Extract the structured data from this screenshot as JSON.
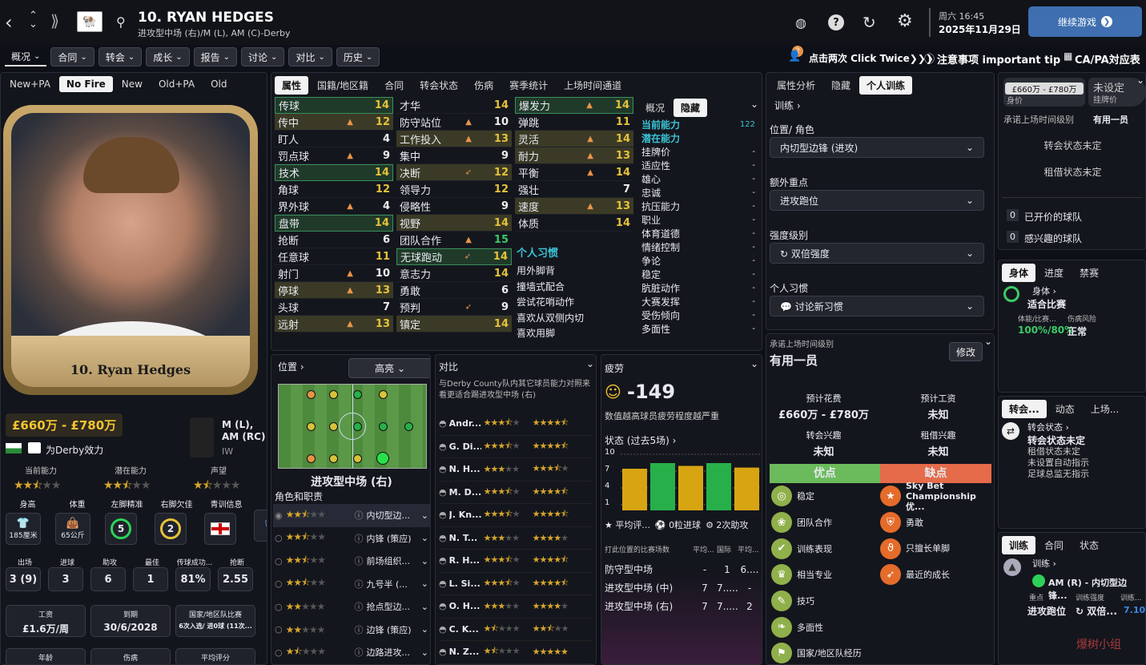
{
  "header": {
    "name": "10. RYAN HEDGES",
    "sub": "进攻型中场 (右)/M (L), AM (C)-Derby",
    "time": "周六 16:45",
    "date": "2025年11月29日",
    "continue": "继续游戏"
  },
  "menu": [
    "概况",
    "合同",
    "转会",
    "成长",
    "报告",
    "讨论",
    "对比",
    "历史"
  ],
  "tips": {
    "badge": "2",
    "click": "点击两次 Click Twice❯❯❯",
    "important": "注意事项 important tip",
    "capa": "CA/PA対应表"
  },
  "left": {
    "filters": [
      "New+PA",
      "No Fire",
      "New",
      "Old+PA",
      "Old"
    ],
    "card_name": "10. Ryan Hedges",
    "value": "£660万 - £780万",
    "club": "为Derby效力",
    "pos": "M (L), AM (RC)",
    "role": "IW",
    "labels": {
      "ca": "当前能力",
      "pa": "潜在能力",
      "rep": "声望"
    },
    "stats1": [
      {
        "l": "身高",
        "v": "185厘米"
      },
      {
        "l": "体重",
        "v": "65公斤"
      },
      {
        "l": "左脚精准",
        "v": "5"
      },
      {
        "l": "右脚欠佳",
        "v": "2"
      },
      {
        "l": "青训信息",
        "v": ""
      }
    ],
    "stats2": [
      {
        "l": "出场",
        "v": "3 (9)"
      },
      {
        "l": "进球",
        "v": "3"
      },
      {
        "l": "助攻",
        "v": "6"
      },
      {
        "l": "最佳",
        "v": "1"
      },
      {
        "l": "传球成功...",
        "v": "81%"
      },
      {
        "l": "抢断",
        "v": "2.55"
      }
    ],
    "stats3": [
      {
        "l": "工资",
        "v": "£1.6万/周"
      },
      {
        "l": "到期",
        "v": "30/6/2028"
      },
      {
        "l": "国家/地区队比赛",
        "v": "6次入选/ 进0球 (11次..."
      }
    ],
    "stats4": [
      "年龄",
      "伤病",
      "平均评分"
    ]
  },
  "attrs": {
    "tabs": [
      "属性",
      "国籍/地区籍",
      "合同",
      "转会状态",
      "伤病",
      "赛季统计",
      "上场时间通道"
    ],
    "col1": [
      [
        "传球",
        "14"
      ],
      [
        "传中",
        "12"
      ],
      [
        "盯人",
        "4"
      ],
      [
        "罚点球",
        "9"
      ],
      [
        "技术",
        "14"
      ],
      [
        "角球",
        "12"
      ],
      [
        "界外球",
        "4"
      ],
      [
        "盘带",
        "14"
      ],
      [
        "抢断",
        "6"
      ],
      [
        "任意球",
        "11"
      ],
      [
        "射门",
        "10"
      ],
      [
        "停球",
        "13"
      ],
      [
        "头球",
        "7"
      ],
      [
        "远射",
        "13"
      ]
    ],
    "col2": [
      [
        "才华",
        "14"
      ],
      [
        "防守站位",
        "10"
      ],
      [
        "工作投入",
        "13"
      ],
      [
        "集中",
        "9"
      ],
      [
        "决断",
        "12"
      ],
      [
        "领导力",
        "12"
      ],
      [
        "侵略性",
        "9"
      ],
      [
        "视野",
        "14"
      ],
      [
        "团队合作",
        "15"
      ],
      [
        "无球跑动",
        "14"
      ],
      [
        "意志力",
        "14"
      ],
      [
        "勇敢",
        "6"
      ],
      [
        "预判",
        "9"
      ],
      [
        "镇定",
        "14"
      ]
    ],
    "col3": [
      [
        "爆发力",
        "14"
      ],
      [
        "弹跳",
        "11"
      ],
      [
        "灵活",
        "14"
      ],
      [
        "耐力",
        "13"
      ],
      [
        "平衡",
        "14"
      ],
      [
        "强壮",
        "7"
      ],
      [
        "速度",
        "13"
      ],
      [
        "体质",
        "14"
      ]
    ],
    "habits_title": "个人习惯",
    "habits": [
      "用外脚背",
      "撞墙式配合",
      "尝试花哨动作",
      "喜欢从双侧内切",
      "喜欢用脚"
    ],
    "hid_tabs": [
      "概况",
      "隐藏"
    ],
    "hidden": [
      [
        "当前能力",
        "122"
      ],
      [
        "潜在能力",
        ""
      ],
      [
        "挂牌价",
        "-"
      ],
      [
        "适应性",
        "-"
      ],
      [
        "雄心",
        "-"
      ],
      [
        "忠诚",
        "-"
      ],
      [
        "抗压能力",
        "-"
      ],
      [
        "职业",
        "-"
      ],
      [
        "体育道德",
        "-"
      ],
      [
        "情绪控制",
        "-"
      ],
      [
        "争论",
        "-"
      ],
      [
        "稳定",
        "-"
      ],
      [
        "肮脏动作",
        "-"
      ],
      [
        "大赛发挥",
        "-"
      ],
      [
        "受伤倾向",
        "-"
      ],
      [
        "多面性",
        "-"
      ]
    ]
  },
  "position": {
    "title": "位置",
    "highlight": "高亮",
    "role": "进攻型中场 (右)",
    "roles_title": "角色和职责",
    "roles": [
      "内切型边...",
      "内锋 (策应)",
      "前场组织...",
      "九号半 (...",
      "抢点型边...",
      "边锋 (策应)",
      "边路进攻..."
    ]
  },
  "compare": {
    "title": "对比",
    "desc": "与Derby County队内其它球员能力对照来看更适合踢进攻型中场 (右)",
    "players": [
      "Andr...",
      "G. Di...",
      "N. H...",
      "M. D...",
      "J. Kn...",
      "N. T...",
      "R. H...",
      "L. Si...",
      "O. H...",
      "C. K...",
      "N. Z..."
    ]
  },
  "fatigue": {
    "title": "疲劳",
    "value": "-149",
    "desc": "数值越高球员疲劳程度越严重",
    "form": "状态 (过去5场)",
    "bars": [
      7,
      8,
      7.5,
      8,
      7.2
    ],
    "yticks": [
      "10",
      "7",
      "4",
      "1"
    ],
    "legend": [
      "平均评...",
      "0粒进球",
      "2次助攻"
    ],
    "pos_head": [
      "打此位置的比赛场数",
      "平均...",
      "国际",
      "平均..."
    ],
    "pos_rows": [
      [
        "防守型中场",
        "-",
        "1",
        "6...."
      ],
      [
        "进攻型中场 (中)",
        "7",
        "7.....",
        "-"
      ],
      [
        "进攻型中场 (右)",
        "7",
        "7.....",
        "2"
      ]
    ]
  },
  "training": {
    "tabs": [
      "属性分析",
      "隐藏",
      "个人训练"
    ],
    "crumb": "训练",
    "pos_label": "位置/ 角色",
    "pos_val": "内切型边锋 (进攻)",
    "extra_label": "额外重点",
    "extra_val": "进攻跑位",
    "int_label": "强度级别",
    "int_val": "双倍强度",
    "habit_label": "个人习惯",
    "habit_val": "讨论新习惯"
  },
  "promise": {
    "title": "承诺上场时间级别",
    "val": "有用一员",
    "edit": "修改",
    "fee_l": "预计花费",
    "fee_v": "£660万 - £780万",
    "wage_l": "预计工资",
    "wage_v": "未知",
    "int_l": "转会兴趣",
    "int_v": "未知",
    "loan_l": "租借兴趣",
    "loan_v": "未知",
    "pros": "优点",
    "cons": "缺点",
    "pros_list": [
      "稳定",
      "团队合作",
      "训练表现",
      "相当专业",
      "技巧",
      "多面性",
      "国家/地区队经历"
    ],
    "cons_list": [
      "Sky Bet Championship优...",
      "勇敢",
      "只擅长单脚",
      "最近的成长"
    ]
  },
  "far": {
    "price": "£660万 - £780万",
    "price_l": "身价",
    "ask": "未设定",
    "ask_l": "挂牌价",
    "pl": "承诺上场时间级别",
    "pv": "有用一员",
    "s1": "转会状态未定",
    "s2": "租借状态未定",
    "b1": "已开价的球队",
    "b2": "感兴趣的球队",
    "tabs1": [
      "身体",
      "进度",
      "禁赛"
    ],
    "body": "身体",
    "fit": "适合比赛",
    "cond_l": "体能/比赛...",
    "risk_l": "伤病风险",
    "cond": "100%/80%",
    "risk": "正常",
    "tabs2": [
      "转会...",
      "动态",
      "上场..."
    ],
    "ts_l": "转会状态",
    "ts": "转会状态未定",
    "tlines": [
      "租借状态未定",
      "未设置自动指示",
      "足球总监无指示"
    ],
    "tabs3": [
      "训练",
      "合同",
      "状态"
    ],
    "tr": "训练",
    "trrole": "AM (R) - 内切型边锋...",
    "focus_l": "重点",
    "int_l": "训练强度",
    "tr_l": "训练...",
    "focus": "进攻跑位",
    "intv": "双倍...",
    "rating": "7.10"
  },
  "watermark": "爆树小组"
}
